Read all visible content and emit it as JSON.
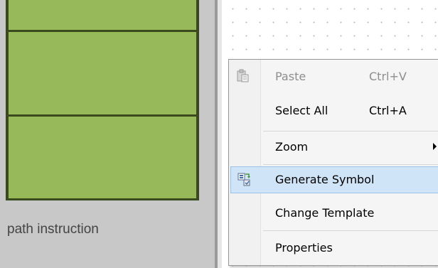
{
  "canvas": {
    "caption": "path instruction",
    "block_color": "#98b95a",
    "border_color": "#3b4a1e"
  },
  "context_menu": {
    "items": [
      {
        "label": "Paste",
        "shortcut": "Ctrl+V",
        "enabled": false,
        "icon": "paste-icon"
      },
      {
        "label": "Select All",
        "shortcut": "Ctrl+A",
        "enabled": true
      },
      {
        "label": "Zoom",
        "submenu": true,
        "enabled": true
      },
      {
        "label": "Generate Symbol",
        "enabled": true,
        "highlighted": true,
        "icon": "generate-symbol-icon"
      },
      {
        "label": "Change Template",
        "enabled": true
      },
      {
        "label": "Properties",
        "enabled": true
      }
    ],
    "highlight_color": "#cfe4f6"
  }
}
